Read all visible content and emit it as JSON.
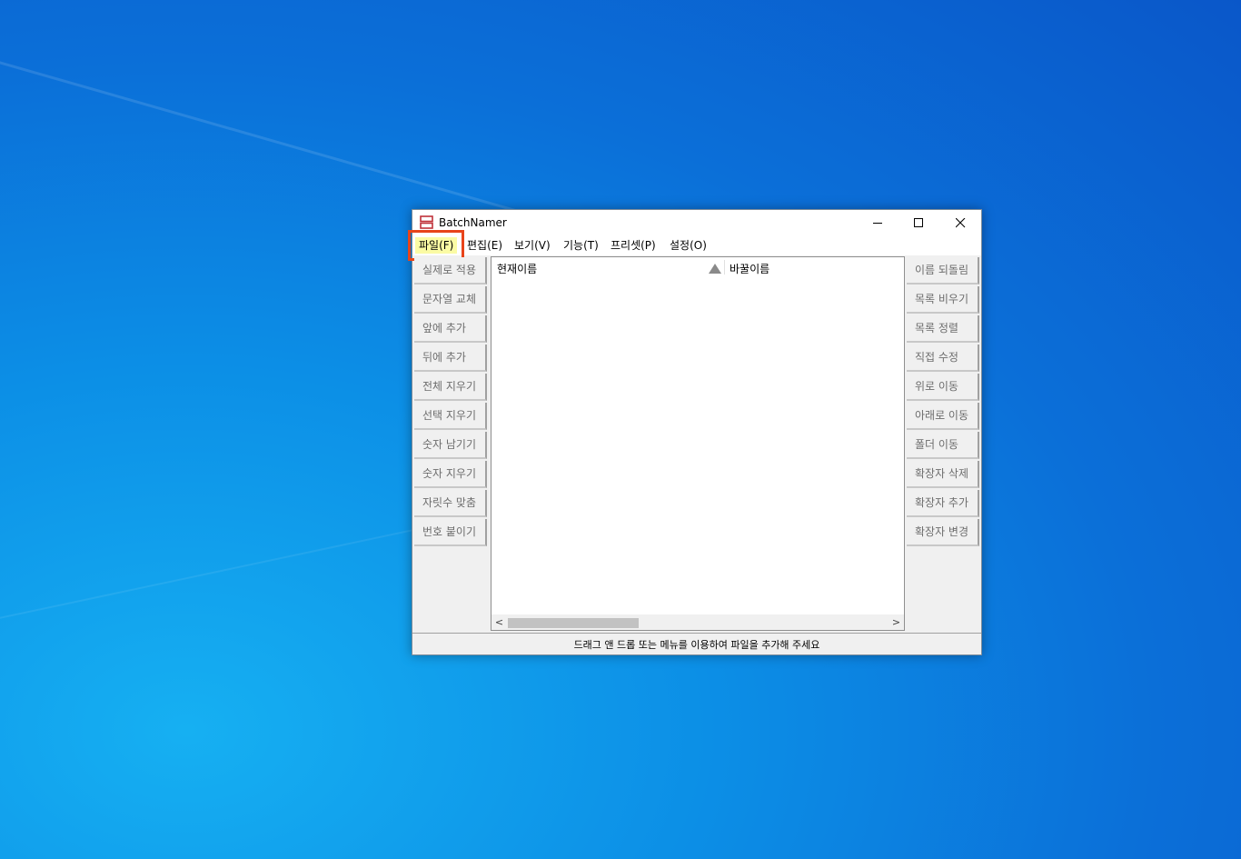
{
  "window": {
    "title": "BatchNamer",
    "minimize_label": "—",
    "maximize_label": "☐",
    "close_label": "✕"
  },
  "menu": [
    {
      "label": "파일(F)"
    },
    {
      "label": "편집(E)"
    },
    {
      "label": "보기(V)"
    },
    {
      "label": "기능(T)"
    },
    {
      "label": "프리셋(P)"
    },
    {
      "label": "설정(O)"
    }
  ],
  "left_buttons": [
    {
      "label": "실제로 적용"
    },
    {
      "label": "문자열 교체"
    },
    {
      "label": "앞에 추가"
    },
    {
      "label": "뒤에 추가"
    },
    {
      "label": "전체 지우기"
    },
    {
      "label": "선택 지우기"
    },
    {
      "label": "숫자 남기기"
    },
    {
      "label": "숫자 지우기"
    },
    {
      "label": "자릿수 맞춤"
    },
    {
      "label": "번호 붙이기"
    }
  ],
  "right_buttons": [
    {
      "label": "이름 되돌림"
    },
    {
      "label": "목록 비우기"
    },
    {
      "label": "목록 정렬"
    },
    {
      "label": "직접 수정"
    },
    {
      "label": "위로 이동"
    },
    {
      "label": "아래로 이동"
    },
    {
      "label": "폴더 이동"
    },
    {
      "label": "확장자 삭제"
    },
    {
      "label": "확장자 추가"
    },
    {
      "label": "확장자 변경"
    }
  ],
  "list": {
    "columns": [
      {
        "label": "현재이름"
      },
      {
        "label": "바꿀이름"
      }
    ],
    "scroll_left": "<",
    "scroll_right": ">"
  },
  "status": {
    "text": "드래그 앤 드롭 또는 메뉴를 이용하여 파일을 추가해 주세요"
  },
  "colors": {
    "highlight_outline": "#e8441a",
    "active_menu_bg": "#fbfba4",
    "desktop_blue": "#0b6fd8"
  }
}
